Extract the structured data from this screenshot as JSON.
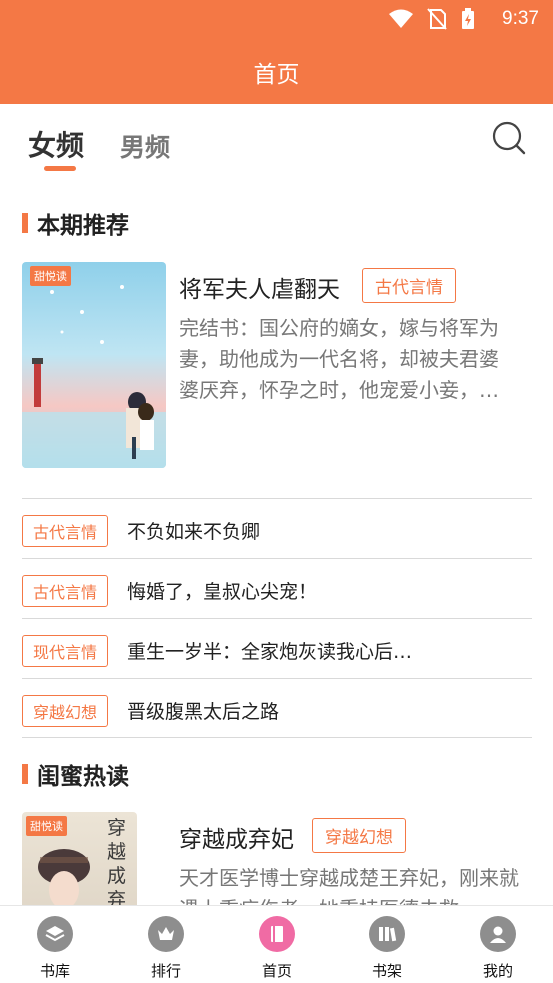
{
  "status": {
    "time": "9:37"
  },
  "header": {
    "title": "首页"
  },
  "tabs": {
    "female": "女频",
    "male": "男频"
  },
  "section1": {
    "title": "本期推荐"
  },
  "featured": {
    "title": "将军夫人虐翻天",
    "tag": "古代言情",
    "desc": "完结书：国公府的嫡女，嫁与将军为妻，助他成为一代名将，却被夫君婆婆厌弃，怀孕之时，他宠爱小妾，…",
    "cover_logo": "甜悦读"
  },
  "list": [
    {
      "tag": "古代言情",
      "title": "不负如来不负卿"
    },
    {
      "tag": "古代言情",
      "title": "悔婚了，皇叔心尖宠！"
    },
    {
      "tag": "现代言情",
      "title": "重生一岁半：全家炮灰读我心后…"
    },
    {
      "tag": "穿越幻想",
      "title": "晋级腹黑太后之路"
    }
  ],
  "section2": {
    "title": "闺蜜热读"
  },
  "featured2": {
    "title": "穿越成弃妃",
    "tag": "穿越幻想",
    "desc": "天才医学博士穿越成楚王弃妃，刚来就遇上重症伤者，她秉持医德去救",
    "cover_logo": "甜悦读",
    "cover_text": "穿越成弃"
  },
  "nav": [
    {
      "label": "书库",
      "icon": "layers-icon"
    },
    {
      "label": "排行",
      "icon": "crown-icon"
    },
    {
      "label": "首页",
      "icon": "book-icon"
    },
    {
      "label": "书架",
      "icon": "bookshelf-icon"
    },
    {
      "label": "我的",
      "icon": "user-icon"
    }
  ],
  "colors": {
    "accent": "#f47845",
    "nav_active": "#f06ba4",
    "nav_icon": "#8e8e8e"
  }
}
